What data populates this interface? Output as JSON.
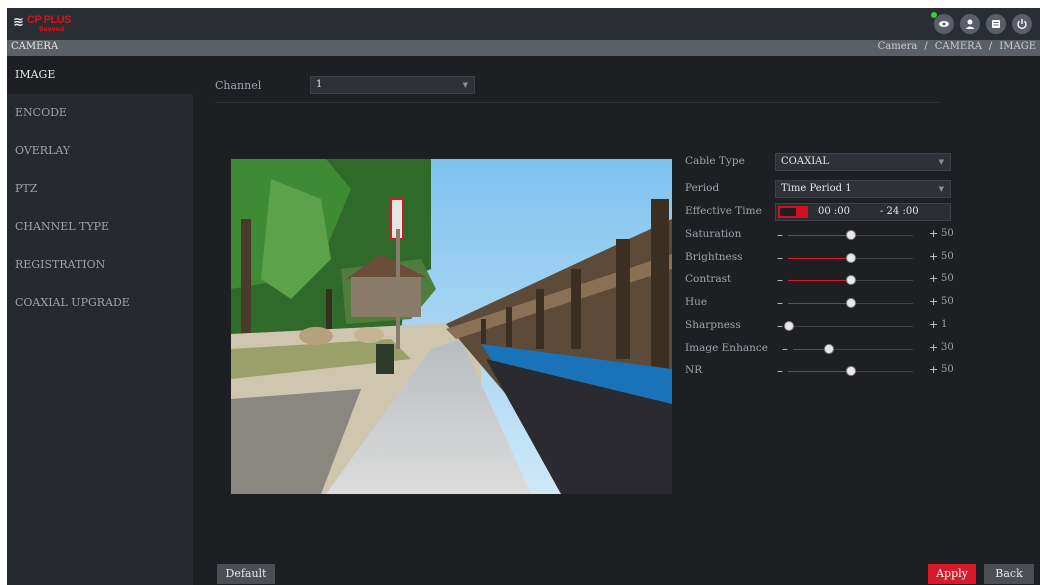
{
  "logo": {
    "mark": "≋",
    "brand": "CP PLUS",
    "sub": "Beyond"
  },
  "header": {
    "title": "CAMERA",
    "breadcrumb": [
      "Camera",
      "CAMERA",
      "IMAGE"
    ]
  },
  "topbar_icons": [
    "eye-icon",
    "user-icon",
    "menu-icon",
    "power-icon"
  ],
  "sidebar": {
    "items": [
      {
        "label": "IMAGE",
        "active": true
      },
      {
        "label": "ENCODE"
      },
      {
        "label": "OVERLAY"
      },
      {
        "label": "PTZ"
      },
      {
        "label": "CHANNEL TYPE"
      },
      {
        "label": "REGISTRATION"
      },
      {
        "label": "COAXIAL UPGRADE"
      }
    ]
  },
  "channel": {
    "label": "Channel",
    "value": "1"
  },
  "settings": {
    "cable_type": {
      "label": "Cable Type",
      "value": "COAXIAL"
    },
    "period": {
      "label": "Period",
      "value": "Time Period 1"
    },
    "effective_time": {
      "label": "Effective Time",
      "start": "00 :00",
      "end": "- 24 :00"
    },
    "sliders": [
      {
        "label": "Saturation",
        "value": 50,
        "display": "50"
      },
      {
        "label": "Brightness",
        "value": 50,
        "display": "50"
      },
      {
        "label": "Contrast",
        "value": 50,
        "display": "50"
      },
      {
        "label": "Hue",
        "value": 50,
        "display": "50"
      },
      {
        "label": "Sharpness",
        "value": 1,
        "display": "1"
      },
      {
        "label": "Image Enhance",
        "value": 30,
        "display": "30"
      },
      {
        "label": "NR",
        "value": 50,
        "display": "50"
      }
    ]
  },
  "buttons": {
    "default": "Default",
    "apply": "Apply",
    "back": "Back"
  },
  "colors": {
    "accent": "#d7192a",
    "background": "#1d1f23",
    "sidebar": "#26292e"
  }
}
